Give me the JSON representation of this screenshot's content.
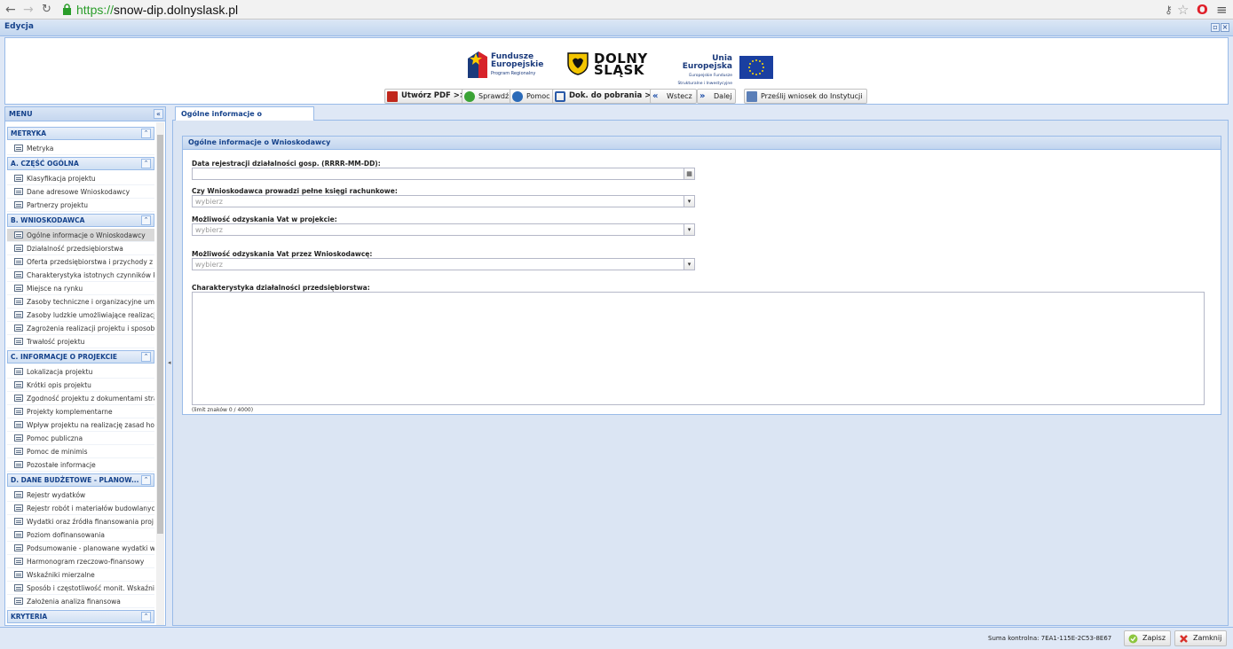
{
  "browser": {
    "url_scheme": "https://",
    "url_domain": "snow-dip.dolnyslask.pl"
  },
  "window": {
    "title": "Edycja"
  },
  "logos": {
    "fe_line1": "Fundusze",
    "fe_line2": "Europejskie",
    "fe_line3": "Program Regionalny",
    "ds_line1": "DOLNY",
    "ds_line2": "ŚLĄSK",
    "ue_line1": "Unia Europejska",
    "ue_line2": "Europejskie Fundusze",
    "ue_line3": "Strukturalne i Inwestycyjne"
  },
  "toolbar": {
    "pdf": "Utwórz PDF >>",
    "check": "Sprawdź",
    "help": "Pomoc",
    "docs": "Dok. do pobrania >>",
    "back": "Wstecz",
    "next": "Dalej",
    "send": "Prześlij wniosek do Instytucji"
  },
  "menu": {
    "title": "MENU",
    "sections": [
      {
        "title": "METRYKA",
        "items": [
          "Metryka"
        ]
      },
      {
        "title": "A. CZĘŚĆ OGÓLNA",
        "items": [
          "Klasyfikacja projektu",
          "Dane adresowe Wnioskodawcy",
          "Partnerzy projektu"
        ]
      },
      {
        "title": "B. WNIOSKODAWCA",
        "items": [
          "Ogólne informacje o Wnioskodawcy",
          "Działalność przedsiębiorstwa",
          "Oferta przedsiębiorstwa i przychody z",
          "Charakterystyka istotnych czynników k",
          "Miejsce na rynku",
          "Zasoby techniczne i organizacyjne umo",
          "Zasoby ludzkie umożliwiające realizacj",
          "Zagrożenia realizacji projektu i sposob",
          "Trwałość projektu"
        ]
      },
      {
        "title": "C. INFORMACJE O PROJEKCIE",
        "items": [
          "Lokalizacja projektu",
          "Krótki opis projektu",
          "Zgodność projektu z dokumentami stra",
          "Projekty komplementarne",
          "Wpływ projektu na realizację zasad ho",
          "Pomoc publiczna",
          "Pomoc de minimis",
          "Pozostałe informacje"
        ]
      },
      {
        "title": "D. DANE BUDŻETOWE - PLANOW...",
        "items": [
          "Rejestr wydatków",
          "Rejestr robót i materiałów budowlanyc",
          "Wydatki oraz źródła finansowania proj",
          "Poziom dofinansowania",
          "Podsumowanie - planowane wydatki w",
          "Harmonogram rzeczowo-finansowy",
          "Wskaźniki mierzalne",
          "Sposób i częstotliwość monit. Wskaźni",
          "Założenia analiza finansowa"
        ]
      },
      {
        "title": "KRYTERIA",
        "items": []
      }
    ]
  },
  "tab": {
    "label": "Ogólne informacje o Wnioskodawcy"
  },
  "form": {
    "panel_title": "Ogólne informacje o Wnioskodawcy",
    "date_label": "Data rejestracji działalności gosp. (RRRR-MM-DD):",
    "books_label": "Czy Wnioskodawca prowadzi pełne księgi rachunkowe:",
    "books_value": "wybierz",
    "vat_project_label": "Możliwość odzyskania Vat w projekcie:",
    "vat_project_value": "wybierz",
    "vat_applicant_label": "Możliwość odzyskania Vat przez Wnioskodawcę:",
    "vat_applicant_value": "wybierz",
    "char_label": "Charakterystyka działalności przedsiębiorstwa:",
    "char_limit": "(limit znaków 0 / 4000)"
  },
  "status": {
    "checksum": "Suma kontrolna: 7EA1-115E-2C53-8E67",
    "save": "Zapisz",
    "close": "Zamknij"
  }
}
